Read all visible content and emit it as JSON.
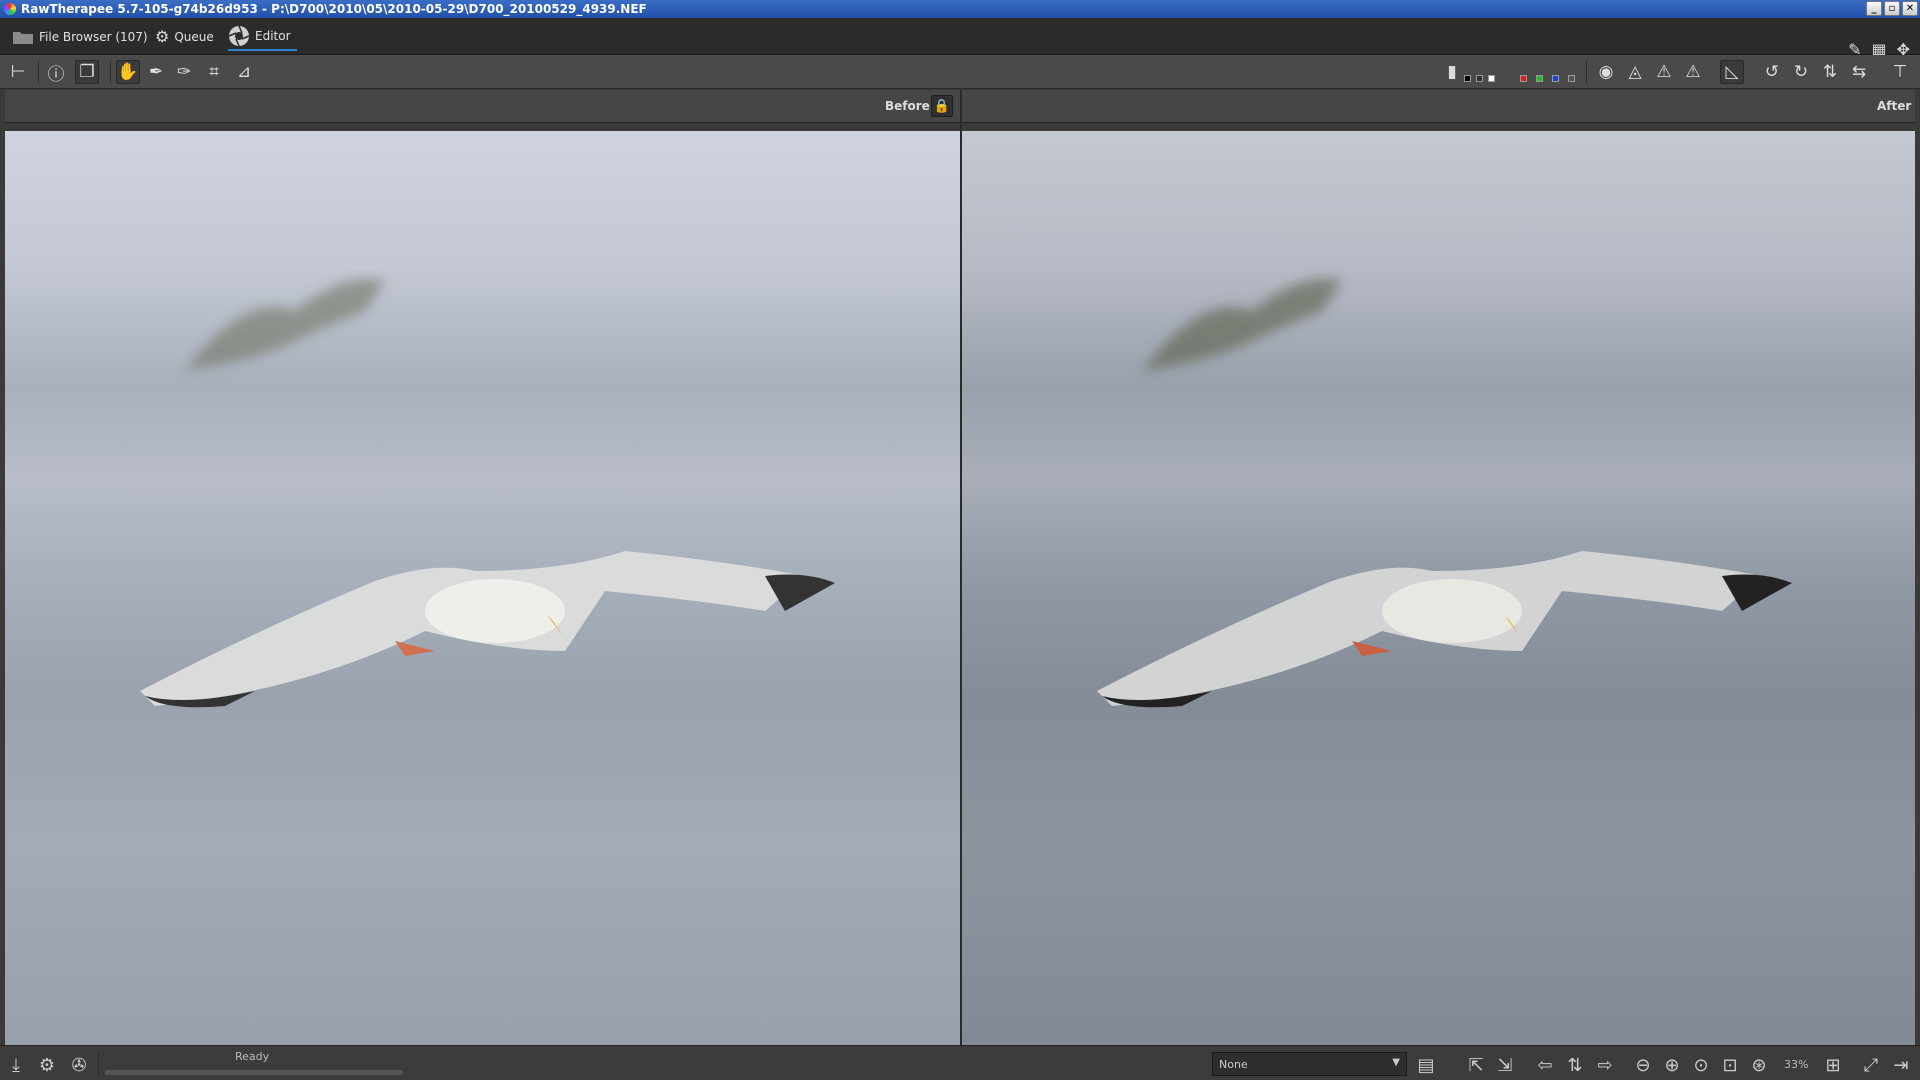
{
  "window": {
    "title": "RawTherapee 5.7-105-g74b26d953 - P:\\D700\\2010\\05\\2010-05-29\\D700_20100529_4939.NEF",
    "min_label": "_",
    "max_label": "▫",
    "close_label": "✕"
  },
  "tabs": [
    {
      "label": "File Browser (107)",
      "icon": "folder-icon"
    },
    {
      "label": "Queue",
      "icon": "gears-icon"
    },
    {
      "label": "Editor",
      "icon": "aperture-icon",
      "active": true
    }
  ],
  "panes": {
    "before_label": "Before",
    "after_label": "After"
  },
  "status": {
    "text": "Ready"
  },
  "profile_select": {
    "value": "None"
  },
  "zoom": {
    "value": "33%"
  },
  "colors": {
    "accent": "#2f7fd0",
    "title_bar": "#2351a8"
  }
}
